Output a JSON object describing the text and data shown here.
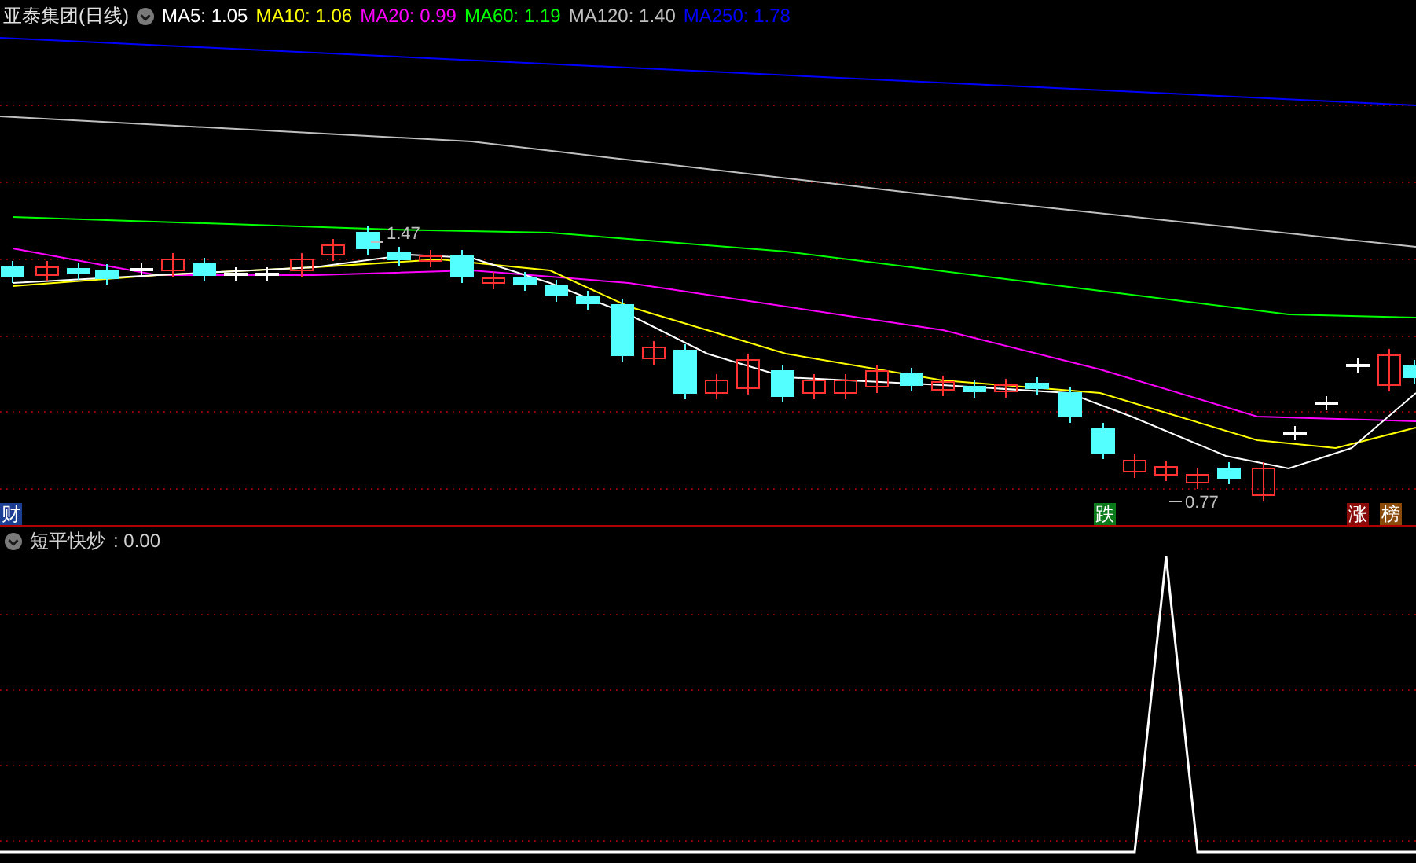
{
  "stock_title": "亚泰集团(日线)",
  "ma_legend": [
    {
      "label": "MA5: 1.05",
      "color": "#ffffff"
    },
    {
      "label": "MA10: 1.06",
      "color": "#ffff00"
    },
    {
      "label": "MA20: 0.99",
      "color": "#ff00ff"
    },
    {
      "label": "MA60: 1.19",
      "color": "#00ff00"
    },
    {
      "label": "MA120: 1.40",
      "color": "#c0c0c0"
    },
    {
      "label": "MA250: 1.78",
      "color": "#0000ff"
    }
  ],
  "price_labels": [
    {
      "text": "1.47",
      "kind": "high"
    },
    {
      "text": "0.77",
      "kind": "low"
    }
  ],
  "markers": [
    {
      "text": "财",
      "color": "#1c3f94"
    },
    {
      "text": "跌",
      "color": "#0a7a1a"
    },
    {
      "text": "涨",
      "color": "#8a0a0a"
    },
    {
      "text": "榜",
      "color": "#8a4a0a"
    }
  ],
  "indicator": {
    "title": "短平快炒",
    "value": ": 0.00"
  }
}
